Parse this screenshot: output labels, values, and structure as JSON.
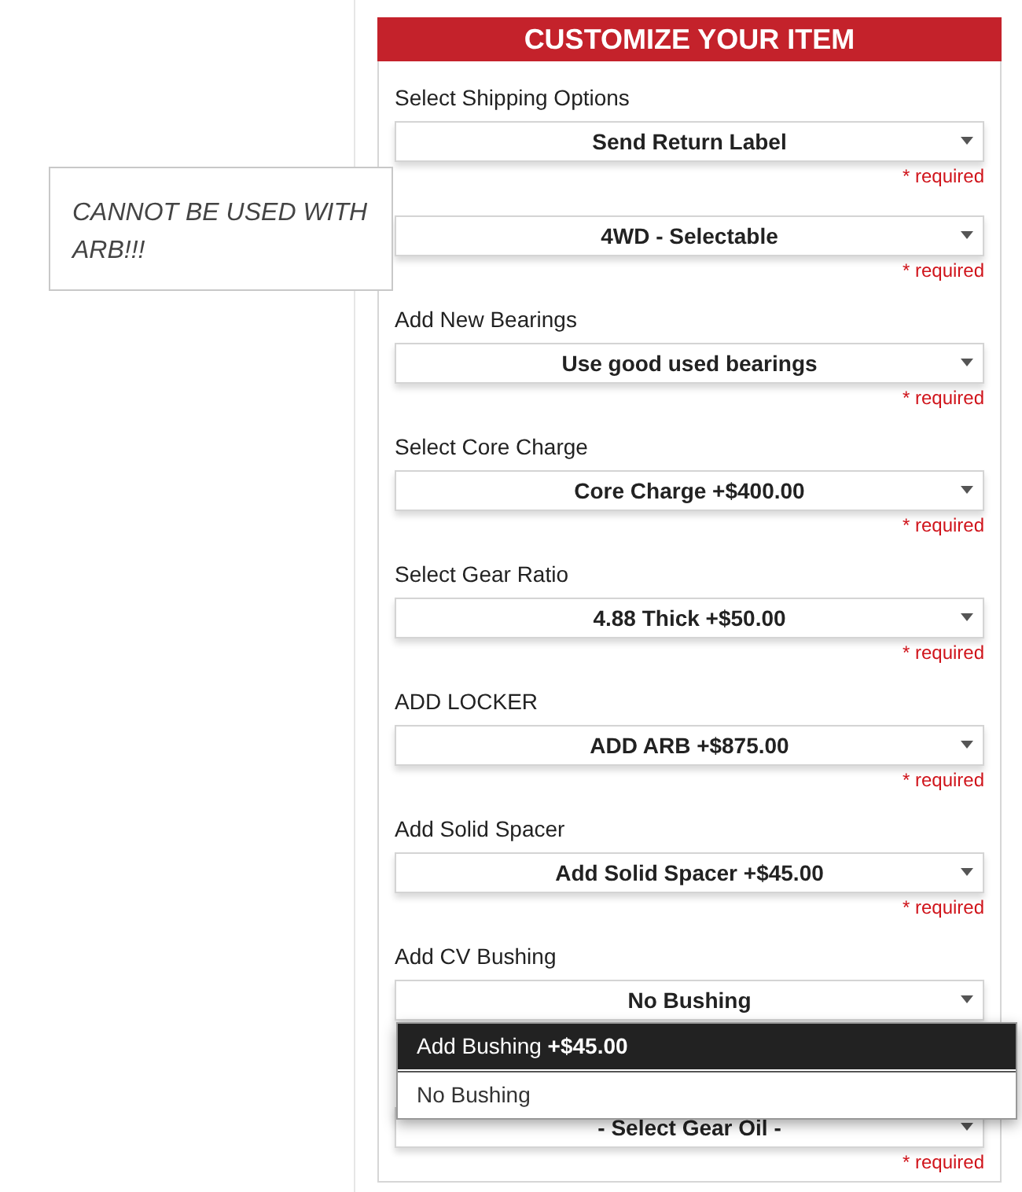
{
  "header": {
    "title": "CUSTOMIZE YOUR ITEM"
  },
  "tooltip": {
    "text": "CANNOT BE USED WITH ARB!!!"
  },
  "fields": [
    {
      "label": "Select Shipping Options",
      "value": "Send Return Label",
      "note": "* required"
    },
    {
      "value": "4WD - Selectable",
      "note": "* required"
    },
    {
      "label": "Add New Bearings",
      "value": "Use good used bearings",
      "note": "* required"
    },
    {
      "label": "Select Core Charge",
      "value": "Core Charge +$400.00",
      "note": "* required"
    },
    {
      "label": "Select Gear Ratio",
      "value": "4.88 Thick +$50.00",
      "note": "* required"
    },
    {
      "label": "ADD LOCKER",
      "value": "ADD ARB +$875.00",
      "note": "* required"
    },
    {
      "label": "Add Solid Spacer",
      "value": "Add Solid Spacer +$45.00",
      "note": "* required"
    },
    {
      "label": "Add CV Bushing",
      "value": "No Bushing",
      "expanded": true,
      "options": [
        {
          "text": "Add Bushing  **+$45.00**",
          "highlighted": true
        },
        {
          "text": "No Bushing",
          "highlighted": false
        }
      ]
    },
    {
      "value": "- Select Gear Oil -",
      "note": "* required"
    }
  ]
}
